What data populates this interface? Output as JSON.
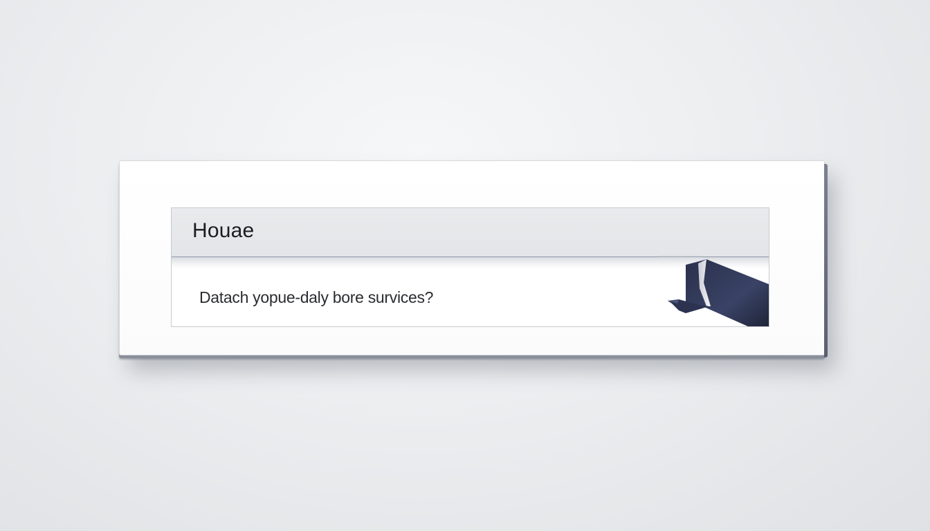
{
  "dialog": {
    "title": "Houae",
    "body_text": "Datach yopue-daly bore survices?"
  },
  "colors": {
    "background": "#e6e8ea",
    "panel": "#ffffff",
    "header": "#e6e7ea",
    "accent_navy": "#2e3553",
    "text": "#1a1c20"
  },
  "icons": {
    "corner": "folded-navy-flap"
  }
}
